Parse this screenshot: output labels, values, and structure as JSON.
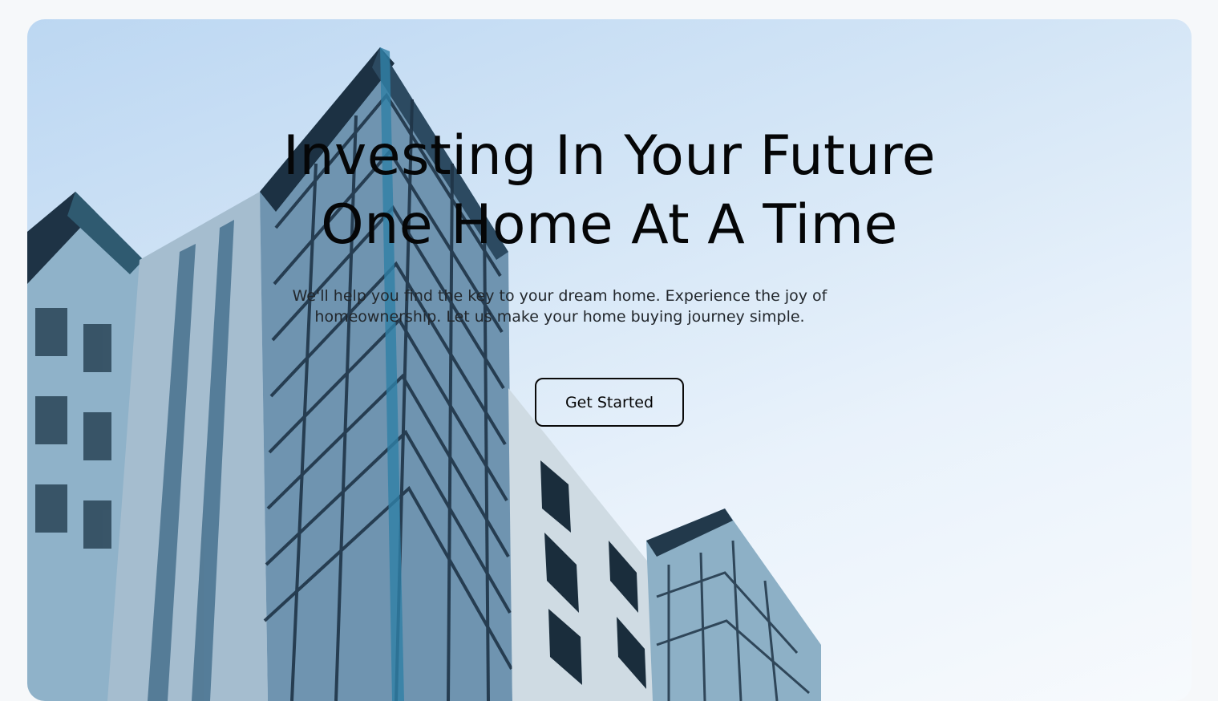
{
  "hero": {
    "headline_line1": "Investing In Your Future",
    "headline_line2": "One Home At A Time",
    "subtext": "We'll help you find the key to your dream home. Experience the joy of homeownership. Let us make your home buying journey simple.",
    "cta_label": "Get Started",
    "background_image": "modern-glass-apartment-building"
  },
  "colors": {
    "page_background": "#f6f8fa",
    "sky_top": "#bcd7f2",
    "sky_bottom": "#f7fafd",
    "building_glass": "#5f86a4",
    "building_frame": "#1f3447",
    "text_primary": "#050607",
    "button_border": "#0a0a0a"
  }
}
